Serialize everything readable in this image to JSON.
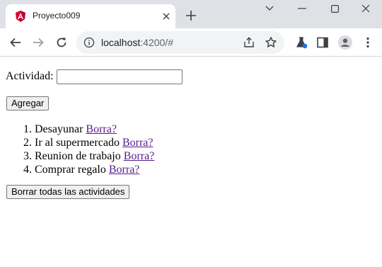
{
  "browser": {
    "tab": {
      "title": "Proyecto009"
    },
    "address_bar": {
      "host": "localhost",
      "path": ":4200/#"
    }
  },
  "page": {
    "activity_label": "Actividad:",
    "activity_input": {
      "value": "",
      "placeholder": ""
    },
    "add_button": "Agregar",
    "todos": [
      {
        "number": "1.",
        "text": "Desayunar",
        "delete_link": "Borra?"
      },
      {
        "number": "2.",
        "text": "Ir al supermercado",
        "delete_link": "Borra?"
      },
      {
        "number": "3.",
        "text": "Reunion de trabajo",
        "delete_link": "Borra?"
      },
      {
        "number": "4.",
        "text": "Comprar regalo",
        "delete_link": "Borra?"
      }
    ],
    "clear_all_button": "Borrar todas las actividades"
  },
  "colors": {
    "tabstrip": "#dee1e6",
    "omnibox": "#f1f3f4",
    "visited_link": "#551a8b",
    "angular_logo": "#dd0031"
  },
  "icons": [
    "angular-favicon-icon",
    "tab-close-icon",
    "new-tab-icon",
    "tab-search-dropdown-icon",
    "window-minimize-icon",
    "window-maximize-icon",
    "window-close-icon",
    "back-arrow-icon",
    "forward-arrow-icon",
    "reload-icon",
    "site-info-icon",
    "share-icon",
    "bookmark-star-icon",
    "extension-flask-icon",
    "side-panel-icon",
    "profile-avatar-icon",
    "kebab-menu-icon"
  ]
}
